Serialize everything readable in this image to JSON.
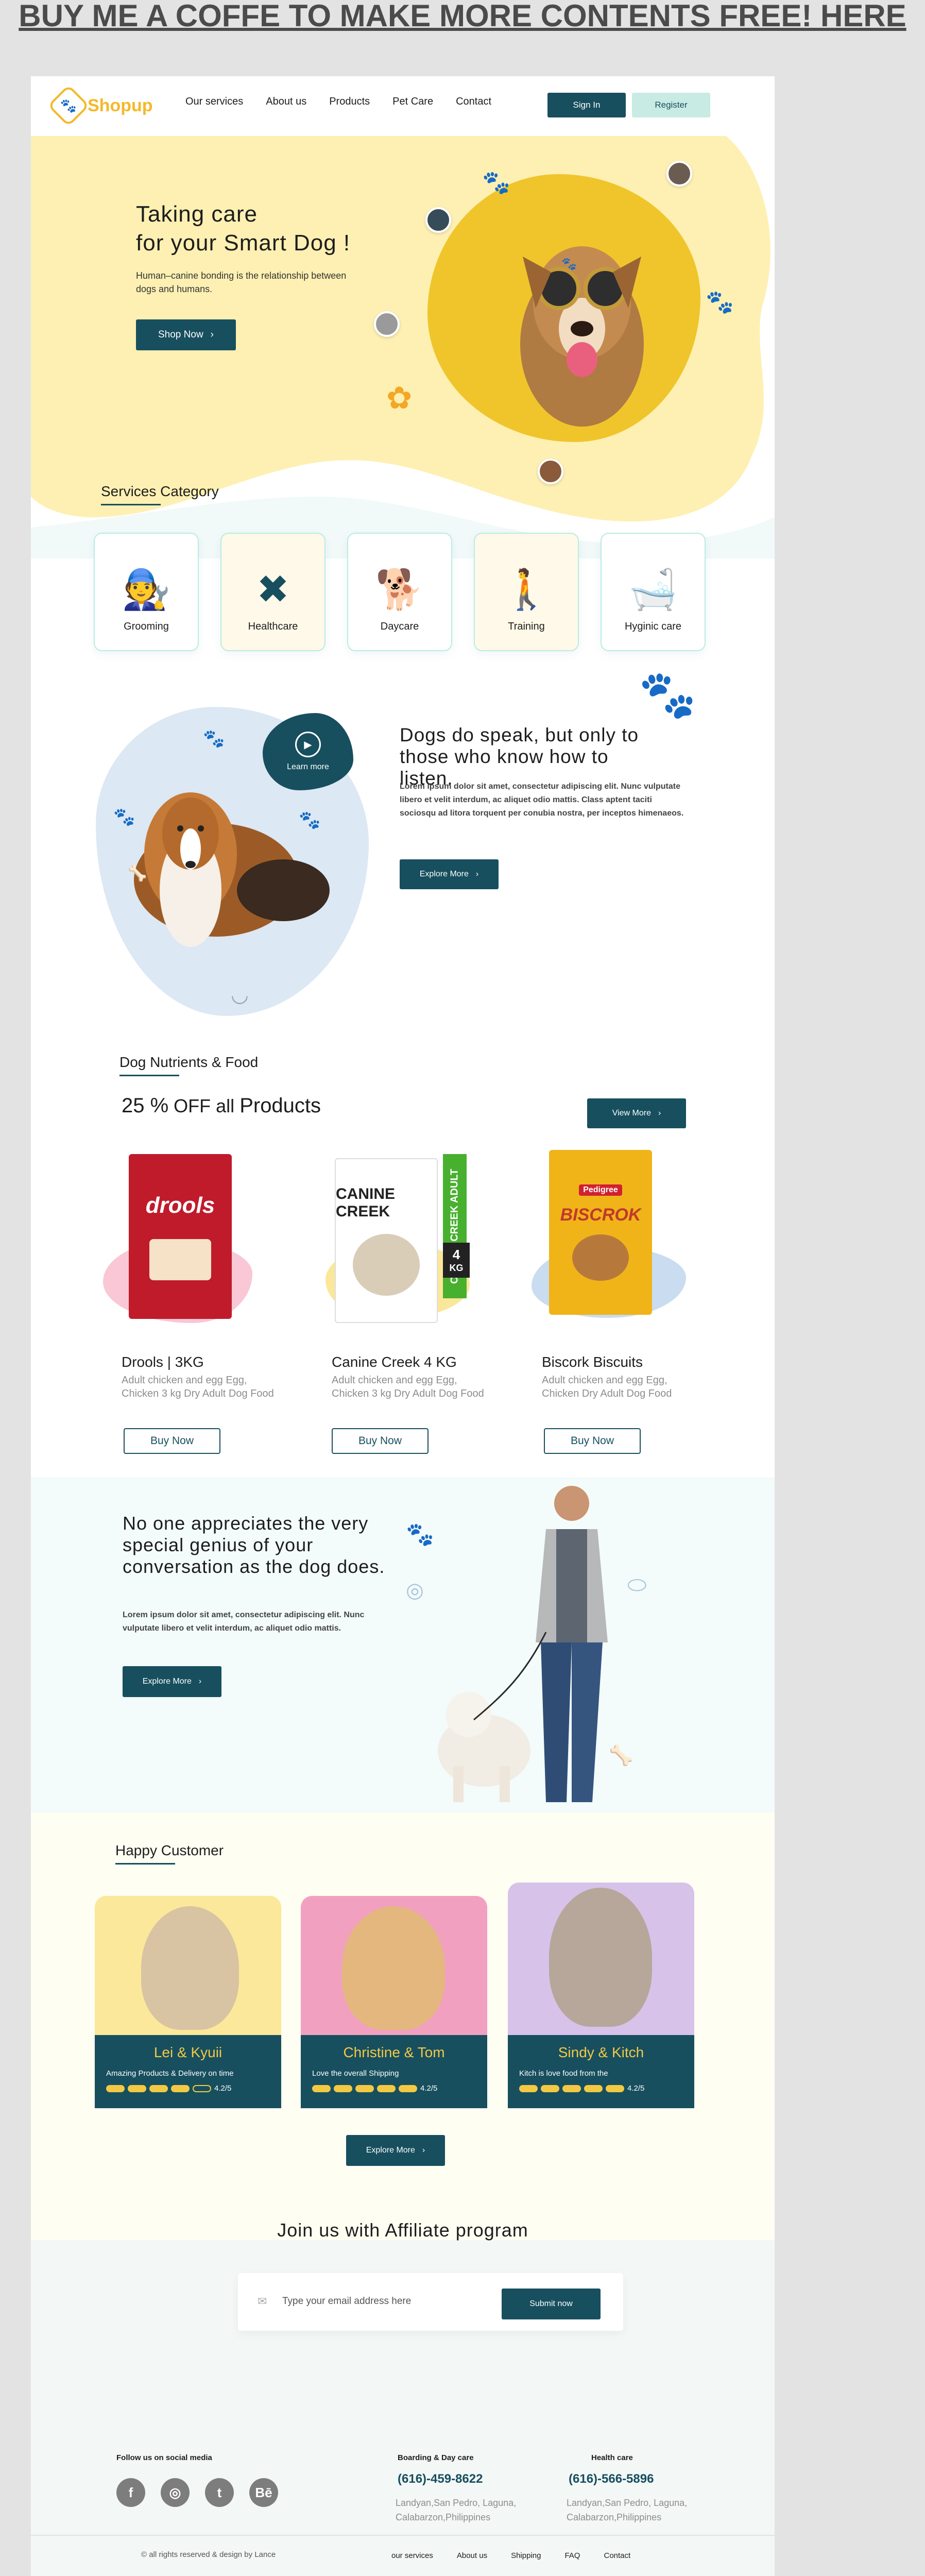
{
  "banner": "BUY ME A COFFE TO MAKE MORE CONTENTS FREE! HERE",
  "header": {
    "logo": "Shopup",
    "nav": [
      "Our services",
      "About us",
      "Products",
      "Pet Care",
      "Contact"
    ],
    "signin": "Sign In",
    "register": "Register"
  },
  "hero": {
    "title_line1": "Taking care",
    "title_line2": "for your Smart Dog !",
    "subtitle": "Human–canine bonding is the relationship between dogs and humans.",
    "cta": "Shop Now"
  },
  "services": {
    "title": "Services Category",
    "items": [
      {
        "label": "Grooming",
        "icon": "groomer-icon",
        "bg": "#ffffff"
      },
      {
        "label": "Healthcare",
        "icon": "bone-icon",
        "bg": "#fef9e8"
      },
      {
        "label": "Daycare",
        "icon": "daycare-icon",
        "bg": "#ffffff"
      },
      {
        "label": "Training",
        "icon": "training-icon",
        "bg": "#fef9e8"
      },
      {
        "label": "Hyginic care",
        "icon": "bath-icon",
        "bg": "#ffffff"
      }
    ]
  },
  "quote": {
    "play_label": "Learn more",
    "title": "Dogs do speak, but only to those who know how to listen.",
    "body": "Lorem ipsum dolor sit amet, consectetur adipiscing elit. Nunc vulputate libero et velit interdum, ac aliquet odio mattis. Class aptent taciti sociosqu ad litora torquent per conubia nostra, per inceptos himenaeos.",
    "cta": "Explore More"
  },
  "products": {
    "title": "Dog Nutrients & Food",
    "offer_num": "25 %",
    "offer_off": "OFF",
    "offer_all": "all",
    "offer_products": "Products",
    "view_more": "View More",
    "items": [
      {
        "name": "Drools | 3KG",
        "desc": "Adult chicken and egg Egg, Chicken 3 kg Dry Adult Dog Food",
        "pack": "drools",
        "buy": "Buy Now",
        "blob": "#f9c7d6",
        "packcolor": "#c01b2b"
      },
      {
        "name": "Canine Creek 4 KG",
        "desc": "Adult chicken and egg Egg, Chicken 3 kg Dry Adult Dog Food",
        "pack": "CANINE CREEK",
        "buy": "Buy Now",
        "blob": "#fbe79a",
        "packcolor": "#ffffff"
      },
      {
        "name": "Biscork Biscuits",
        "desc": "Adult chicken and egg Egg, Chicken  Dry Adult Dog Food",
        "pack": "BISCROK",
        "buy": "Buy Now",
        "blob": "#c9dcf0",
        "packcolor": "#f0b419"
      }
    ],
    "canine_side": "CANINE CREEK ADULT",
    "canine_kg": "4",
    "canine_kg_unit": "KG"
  },
  "appreciate": {
    "title": "No one appreciates the very special genius of your conversation as the dog does.",
    "body": "Lorem ipsum dolor sit amet, consectetur adipiscing elit. Nunc vulputate libero et velit interdum, ac aliquet odio mattis.",
    "cta": "Explore More"
  },
  "customers": {
    "title": "Happy Customer",
    "items": [
      {
        "name": "Lei & Kyuii",
        "text": "Amazing Products & Delivery on time",
        "rating": "4.2/5",
        "bg": "#fbe89a",
        "filled": 4
      },
      {
        "name": "Christine & Tom",
        "text": "Love the overall Shipping",
        "rating": "4.2/5",
        "bg": "#f2a0c0",
        "filled": 5
      },
      {
        "name": "Sindy & Kitch",
        "text": "Kitch is love food from the",
        "rating": "4.2/5",
        "bg": "#d7c2ea",
        "filled": 5
      }
    ],
    "cta": "Explore More"
  },
  "affiliate": {
    "title": "Join us with Affiliate program",
    "placeholder": "Type your email address here",
    "submit": "Submit now"
  },
  "footer": {
    "social_title": "Follow us on social media",
    "social": [
      "f",
      "◎",
      "t",
      "Bē"
    ],
    "boarding_title": "Boarding & Day care",
    "boarding_phone": "(616)-459-8622",
    "boarding_addr": "Landyan,San Pedro, Laguna, Calabarzon,Philippines",
    "health_title": "Health care",
    "health_phone": "(616)-566-5896",
    "health_addr": "Landyan,San Pedro, Laguna, Calabarzon,Philippines",
    "copyright": "© all rights reserved & design  by Lance",
    "links": [
      "our services",
      "About us",
      "Shipping",
      "FAQ",
      "Contact"
    ]
  }
}
